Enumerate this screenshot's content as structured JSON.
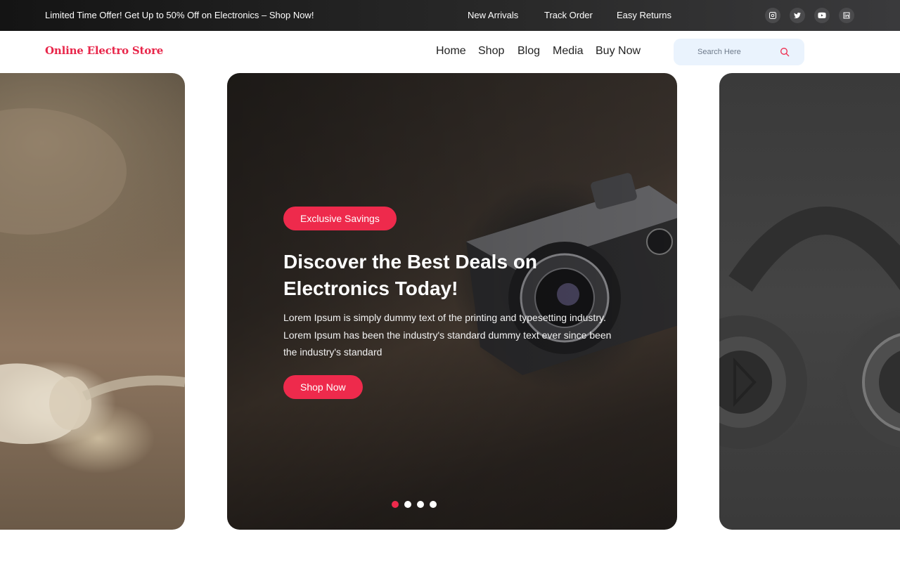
{
  "topbar": {
    "promo": "Limited Time Offer! Get Up to 50% Off on Electronics – Shop Now!",
    "links": [
      "New Arrivals",
      "Track Order",
      "Easy Returns"
    ],
    "social": [
      "instagram-icon",
      "twitter-icon",
      "youtube-icon",
      "linkedin-icon"
    ]
  },
  "header": {
    "logo": "Online Electro Store",
    "nav": [
      "Home",
      "Shop",
      "Blog",
      "Media",
      "Buy Now"
    ],
    "search_placeholder": "Search Here"
  },
  "hero": {
    "badge": "Exclusive Savings",
    "headline": "Discover the Best Deals on Electronics Today!",
    "description": "Lorem Ipsum is simply dummy text of the printing and typesetting industry. Lorem Ipsum has been the industry's standard dummy text ever since been the industry's standard",
    "cta": "Shop Now",
    "slide_count": 4,
    "active_slide": 1
  },
  "colors": {
    "accent": "#ee2a4c",
    "logo": "#e8264a",
    "search_bg": "#eaf3fd"
  }
}
